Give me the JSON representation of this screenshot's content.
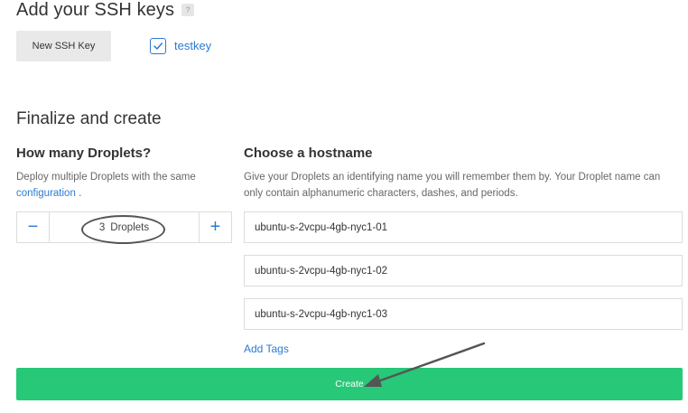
{
  "ssh": {
    "title": "Add your SSH keys",
    "help_badge": "?",
    "new_key_button": "New SSH Key",
    "keys": [
      {
        "name": "testkey",
        "checked": true
      }
    ]
  },
  "finalize": {
    "title": "Finalize and create",
    "droplets": {
      "title": "How many Droplets?",
      "description": "Deploy multiple Droplets with the same",
      "link": "configuration",
      "period": ".",
      "minus": "−",
      "plus": "+",
      "count": "3",
      "unit": "Droplets"
    },
    "hostname": {
      "title": "Choose a hostname",
      "description": "Give your Droplets an identifying name you will remember them by. Your Droplet name can only contain alphanumeric characters, dashes, and periods.",
      "values": [
        "ubuntu-s-2vcpu-4gb-nyc1-01",
        "ubuntu-s-2vcpu-4gb-nyc1-02",
        "ubuntu-s-2vcpu-4gb-nyc1-03"
      ]
    },
    "add_tags": "Add Tags",
    "create_button": "Create"
  },
  "colors": {
    "accent_blue": "#2b7bd3",
    "create_green": "#27c877",
    "annotation": "#555555"
  },
  "icons": {
    "checkbox": "check-icon",
    "annotation_arrow": "arrow-annotation"
  }
}
